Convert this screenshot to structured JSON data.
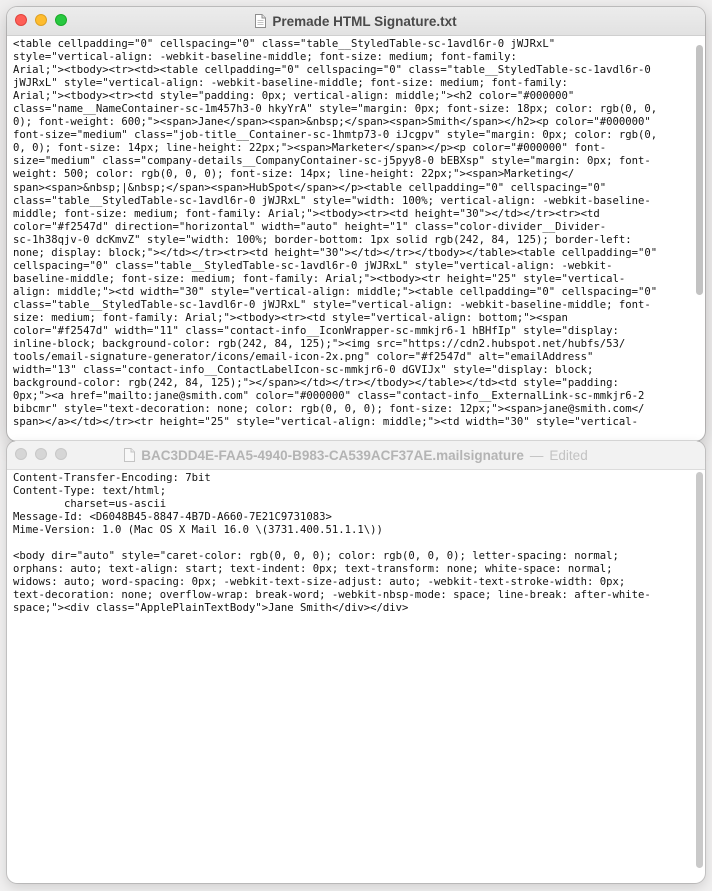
{
  "window1": {
    "title": "Premade HTML Signature.txt",
    "icon": "text-document-icon",
    "lines": [
      "<table cellpadding=\"0\" cellspacing=\"0\" class=\"table__StyledTable-sc-1avdl6r-0 jWJRxL\"",
      "style=\"vertical-align: -webkit-baseline-middle; font-size: medium; font-family:",
      "Arial;\"><tbody><tr><td><table cellpadding=\"0\" cellspacing=\"0\" class=\"table__StyledTable-sc-1avdl6r-0",
      "jWJRxL\" style=\"vertical-align: -webkit-baseline-middle; font-size: medium; font-family:",
      "Arial;\"><tbody><tr><td style=\"padding: 0px; vertical-align: middle;\"><h2 color=\"#000000\"",
      "class=\"name__NameContainer-sc-1m457h3-0 hkyYrA\" style=\"margin: 0px; font-size: 18px; color: rgb(0, 0,",
      "0); font-weight: 600;\"><span>Jane</span><span>&nbsp;</span><span>Smith</span></h2><p color=\"#000000\"",
      "font-size=\"medium\" class=\"job-title__Container-sc-1hmtp73-0 iJcgpv\" style=\"margin: 0px; color: rgb(0,",
      "0, 0); font-size: 14px; line-height: 22px;\"><span>Marketer</span></p><p color=\"#000000\" font-",
      "size=\"medium\" class=\"company-details__CompanyContainer-sc-j5pyy8-0 bEBXsp\" style=\"margin: 0px; font-",
      "weight: 500; color: rgb(0, 0, 0); font-size: 14px; line-height: 22px;\"><span>Marketing</",
      "span><span>&nbsp;|&nbsp;</span><span>HubSpot</span></p><table cellpadding=\"0\" cellspacing=\"0\"",
      "class=\"table__StyledTable-sc-1avdl6r-0 jWJRxL\" style=\"width: 100%; vertical-align: -webkit-baseline-",
      "middle; font-size: medium; font-family: Arial;\"><tbody><tr><td height=\"30\"></td></tr><tr><td",
      "color=\"#f2547d\" direction=\"horizontal\" width=\"auto\" height=\"1\" class=\"color-divider__Divider-",
      "sc-1h38qjv-0 dcKmvZ\" style=\"width: 100%; border-bottom: 1px solid rgb(242, 84, 125); border-left:",
      "none; display: block;\"></td></tr><tr><td height=\"30\"></td></tr></tbody></table><table cellpadding=\"0\"",
      "cellspacing=\"0\" class=\"table__StyledTable-sc-1avdl6r-0 jWJRxL\" style=\"vertical-align: -webkit-",
      "baseline-middle; font-size: medium; font-family: Arial;\"><tbody><tr height=\"25\" style=\"vertical-",
      "align: middle;\"><td width=\"30\" style=\"vertical-align: middle;\"><table cellpadding=\"0\" cellspacing=\"0\"",
      "class=\"table__StyledTable-sc-1avdl6r-0 jWJRxL\" style=\"vertical-align: -webkit-baseline-middle; font-",
      "size: medium; font-family: Arial;\"><tbody><tr><td style=\"vertical-align: bottom;\"><span",
      "color=\"#f2547d\" width=\"11\" class=\"contact-info__IconWrapper-sc-mmkjr6-1 hBHfIp\" style=\"display:",
      "inline-block; background-color: rgb(242, 84, 125);\"><img src=\"https://cdn2.hubspot.net/hubfs/53/",
      "tools/email-signature-generator/icons/email-icon-2x.png\" color=\"#f2547d\" alt=\"emailAddress\"",
      "width=\"13\" class=\"contact-info__ContactLabelIcon-sc-mmkjr6-0 dGVIJx\" style=\"display: block;",
      "background-color: rgb(242, 84, 125);\"></span></td></tr></tbody></table></td><td style=\"padding:",
      "0px;\"><a href=\"mailto:jane@smith.com\" color=\"#000000\" class=\"contact-info__ExternalLink-sc-mmkjr6-2",
      "bibcmr\" style=\"text-decoration: none; color: rgb(0, 0, 0); font-size: 12px;\"><span>jane@smith.com</",
      "span></a></td></tr><tr height=\"25\" style=\"vertical-align: middle;\"><td width=\"30\" style=\"vertical-"
    ]
  },
  "window2": {
    "title": "BAC3DD4E-FAA5-4940-B983-CA539ACF37AE.mailsignature",
    "title_separator": "—",
    "status": "Edited",
    "icon": "text-document-icon",
    "lines": [
      "Content-Transfer-Encoding: 7bit",
      "Content-Type: text/html;",
      "        charset=us-ascii",
      "Message-Id: <D6048B45-8847-4B7D-A660-7E21C9731083>",
      "Mime-Version: 1.0 (Mac OS X Mail 16.0 \\(3731.400.51.1.1\\))",
      "",
      "<body dir=\"auto\" style=\"caret-color: rgb(0, 0, 0); color: rgb(0, 0, 0); letter-spacing: normal;",
      "orphans: auto; text-align: start; text-indent: 0px; text-transform: none; white-space: normal;",
      "widows: auto; word-spacing: 0px; -webkit-text-size-adjust: auto; -webkit-text-stroke-width: 0px;",
      "text-decoration: none; overflow-wrap: break-word; -webkit-nbsp-mode: space; line-break: after-white-",
      "space;\"><div class=\"ApplePlainTextBody\">Jane Smith</div></div>"
    ]
  },
  "colors": {
    "close": "#fe5f57",
    "minimize": "#febc2e",
    "zoom": "#28c840",
    "inactive_light": "#d6d6d6"
  }
}
